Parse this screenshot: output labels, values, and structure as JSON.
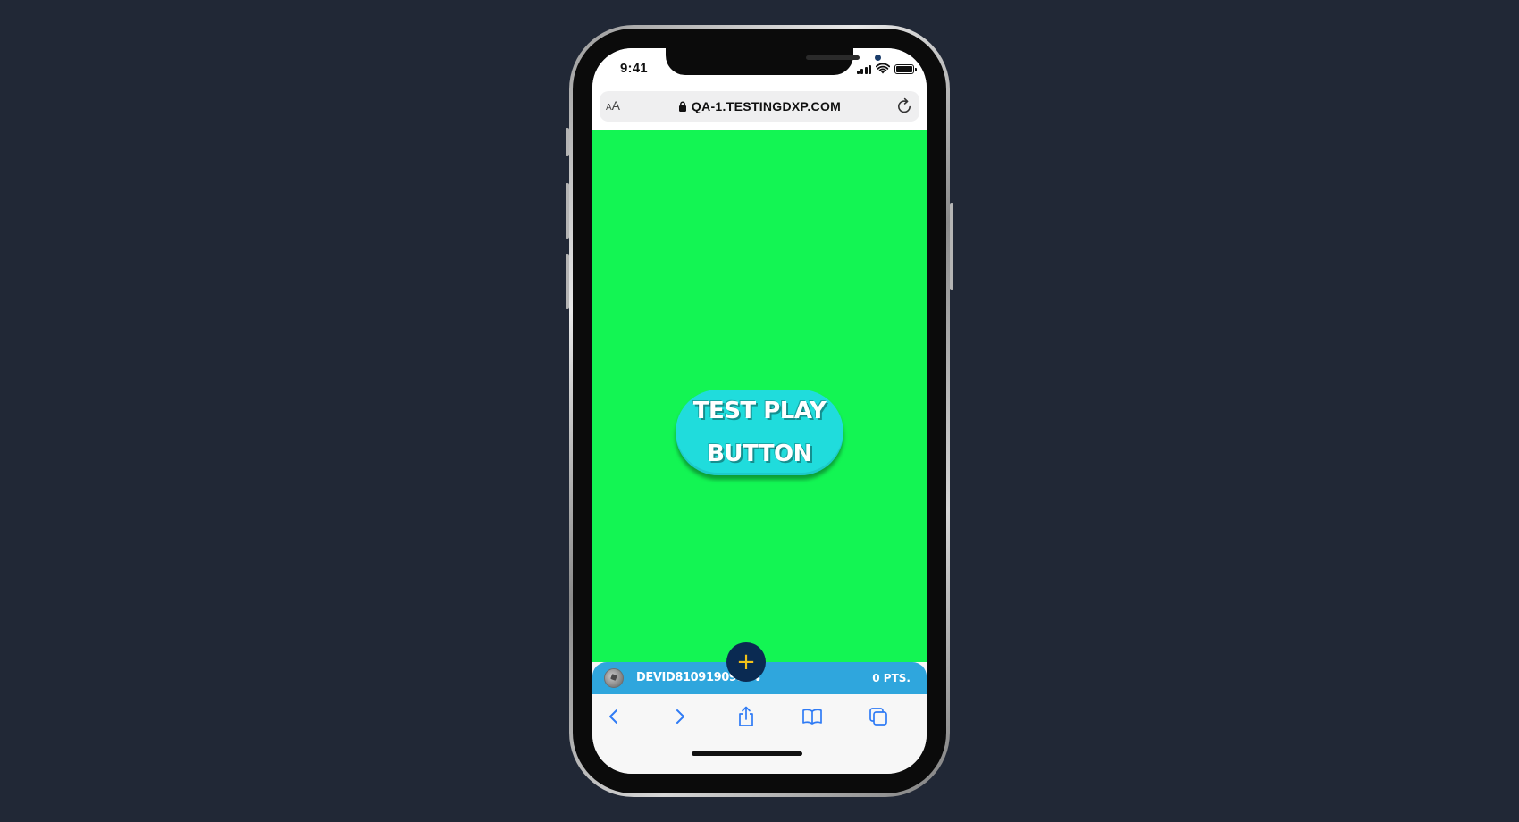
{
  "status_bar": {
    "time": "9:41"
  },
  "browser": {
    "text_size_label_small": "A",
    "text_size_label_large": "A",
    "url": "QA-1.TESTINGDXP.COM"
  },
  "content": {
    "background_color": "#13f553",
    "play_button": {
      "label_line1": "TEST PLAY",
      "label_line2": "BUTTON",
      "color": "#20dcdc"
    }
  },
  "player_bar": {
    "username": "DEVID81091909964",
    "points": "0 PTS.",
    "add_label": "+",
    "color": "#2fa6dd"
  },
  "toolbar": {
    "icons": [
      "back-icon",
      "forward-icon",
      "share-icon",
      "bookmarks-icon",
      "tabs-icon"
    ]
  }
}
